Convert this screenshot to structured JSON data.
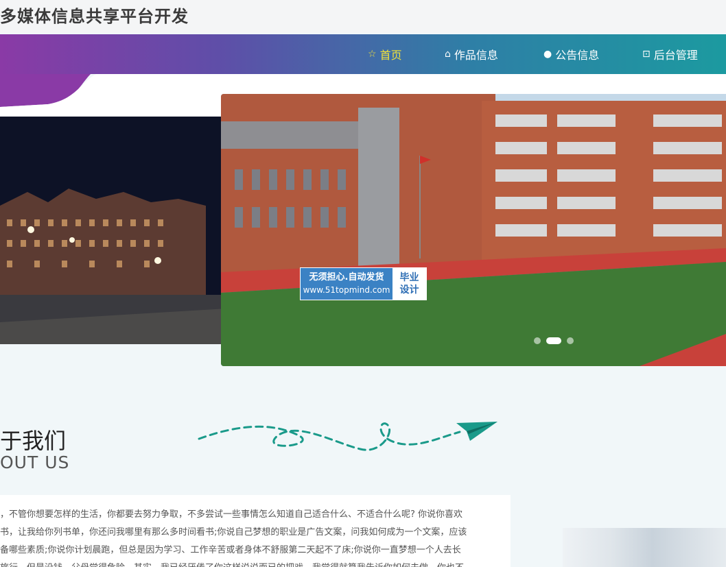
{
  "site": {
    "title": "多媒体信息共享平台开发"
  },
  "nav": [
    {
      "label": "首页",
      "icon": "star-icon",
      "active": true
    },
    {
      "label": "作品信息",
      "icon": "home-icon",
      "active": false
    },
    {
      "label": "公告信息",
      "icon": "info-icon",
      "active": false
    },
    {
      "label": "后台管理",
      "icon": "dashboard-icon",
      "active": false
    }
  ],
  "banner": {
    "slides": 3,
    "active_slide": 2
  },
  "watermark": {
    "line1": "无须担心.自动发货",
    "line2": "www.51topmind.com",
    "right1": "毕业",
    "right2": "设计"
  },
  "about": {
    "title": "于我们",
    "subtitle": "OUT US",
    "lines": [
      "，不管你想要怎样的生活，你都要去努力争取，不多尝试一些事情怎么知道自己适合什么、不适合什么呢? 你说你喜欢",
      "书，让我给你列书单，你还问我哪里有那么多时间看书;你说自己梦想的职业是广告文案，问我如何成为一个文案，应该",
      "备哪些素质;你说你计划晨跑，但总是因为学习、工作辛苦或者身体不舒服第二天起不了床;你说你一直梦想一个人去长",
      "旅行，但是没钱，父母觉得危险。其实，我已经厌倦了你这样说说而已的把戏，我觉得就算我告诉你如何去做，你也不"
    ]
  },
  "colors": {
    "nav_start": "#8a3aa6",
    "nav_end": "#1c9aa0",
    "nav_active": "#f3e13a",
    "doodle": "#1a9a8a"
  }
}
